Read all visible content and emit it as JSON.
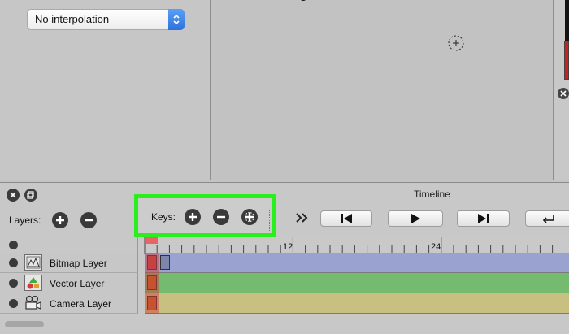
{
  "interpolation": {
    "selected": "No interpolation"
  },
  "timeline": {
    "title": "Timeline",
    "layers_label": "Layers:",
    "keys_label": "Keys:",
    "ruler_labels": [
      "12",
      "24"
    ],
    "layers": [
      {
        "name": "Bitmap Layer",
        "icon": "bitmap-layer-icon"
      },
      {
        "name": "Vector Layer",
        "icon": "vector-layer-icon"
      },
      {
        "name": "Camera Layer",
        "icon": "camera-layer-icon"
      }
    ]
  },
  "colors": {
    "highlight_box": "#2bee1f",
    "bitmap_track": "#9aa3cf",
    "vector_track": "#74bb6f",
    "camera_track": "#c8c080",
    "playhead": "#e86565"
  }
}
